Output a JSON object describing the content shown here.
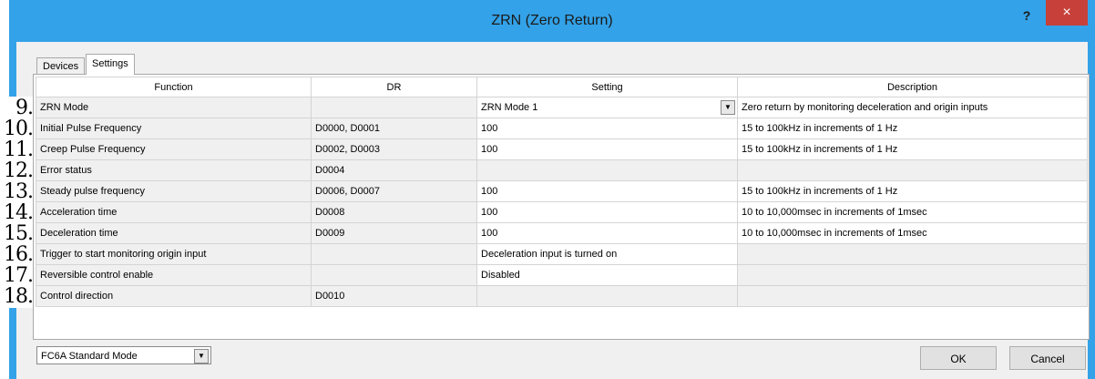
{
  "window": {
    "title": "ZRN (Zero Return)",
    "help": "?",
    "close": "×"
  },
  "tabs": [
    "Devices",
    "Settings"
  ],
  "table": {
    "headers": [
      "Function",
      "DR",
      "Setting",
      "Description"
    ],
    "rows": [
      {
        "num": "9.",
        "function": "ZRN Mode",
        "dr": "",
        "setting": "ZRN Mode 1",
        "description": "Zero return by monitoring deceleration and origin inputs"
      },
      {
        "num": "10.",
        "function": "Initial Pulse Frequency",
        "dr": "D0000, D0001",
        "setting": "100",
        "description": "15 to 100kHz in increments of 1 Hz"
      },
      {
        "num": "11.",
        "function": "Creep Pulse Frequency",
        "dr": "D0002, D0003",
        "setting": "100",
        "description": "15 to 100kHz in increments of 1 Hz"
      },
      {
        "num": "12.",
        "function": "Error status",
        "dr": "D0004",
        "setting": "",
        "description": ""
      },
      {
        "num": "13.",
        "function": "Steady pulse frequency",
        "dr": "D0006, D0007",
        "setting": "100",
        "description": "15 to 100kHz in increments of 1 Hz"
      },
      {
        "num": "14.",
        "function": "Acceleration time",
        "dr": "D0008",
        "setting": "100",
        "description": "10 to 10,000msec in increments of 1msec"
      },
      {
        "num": "15.",
        "function": "Deceleration time",
        "dr": "D0009",
        "setting": "100",
        "description": "10 to 10,000msec in increments of 1msec"
      },
      {
        "num": "16.",
        "function": "Trigger to start monitoring origin input",
        "dr": "",
        "setting": "Deceleration input is turned on",
        "description": ""
      },
      {
        "num": "17.",
        "function": "Reversible control enable",
        "dr": "",
        "setting": "Disabled",
        "description": ""
      },
      {
        "num": "18.",
        "function": "Control direction",
        "dr": "D0010",
        "setting": "",
        "description": ""
      }
    ]
  },
  "footer": {
    "mode": "FC6A Standard Mode",
    "ok": "OK",
    "cancel": "Cancel"
  },
  "icons": {
    "dropdown": "chevron-down-icon"
  }
}
